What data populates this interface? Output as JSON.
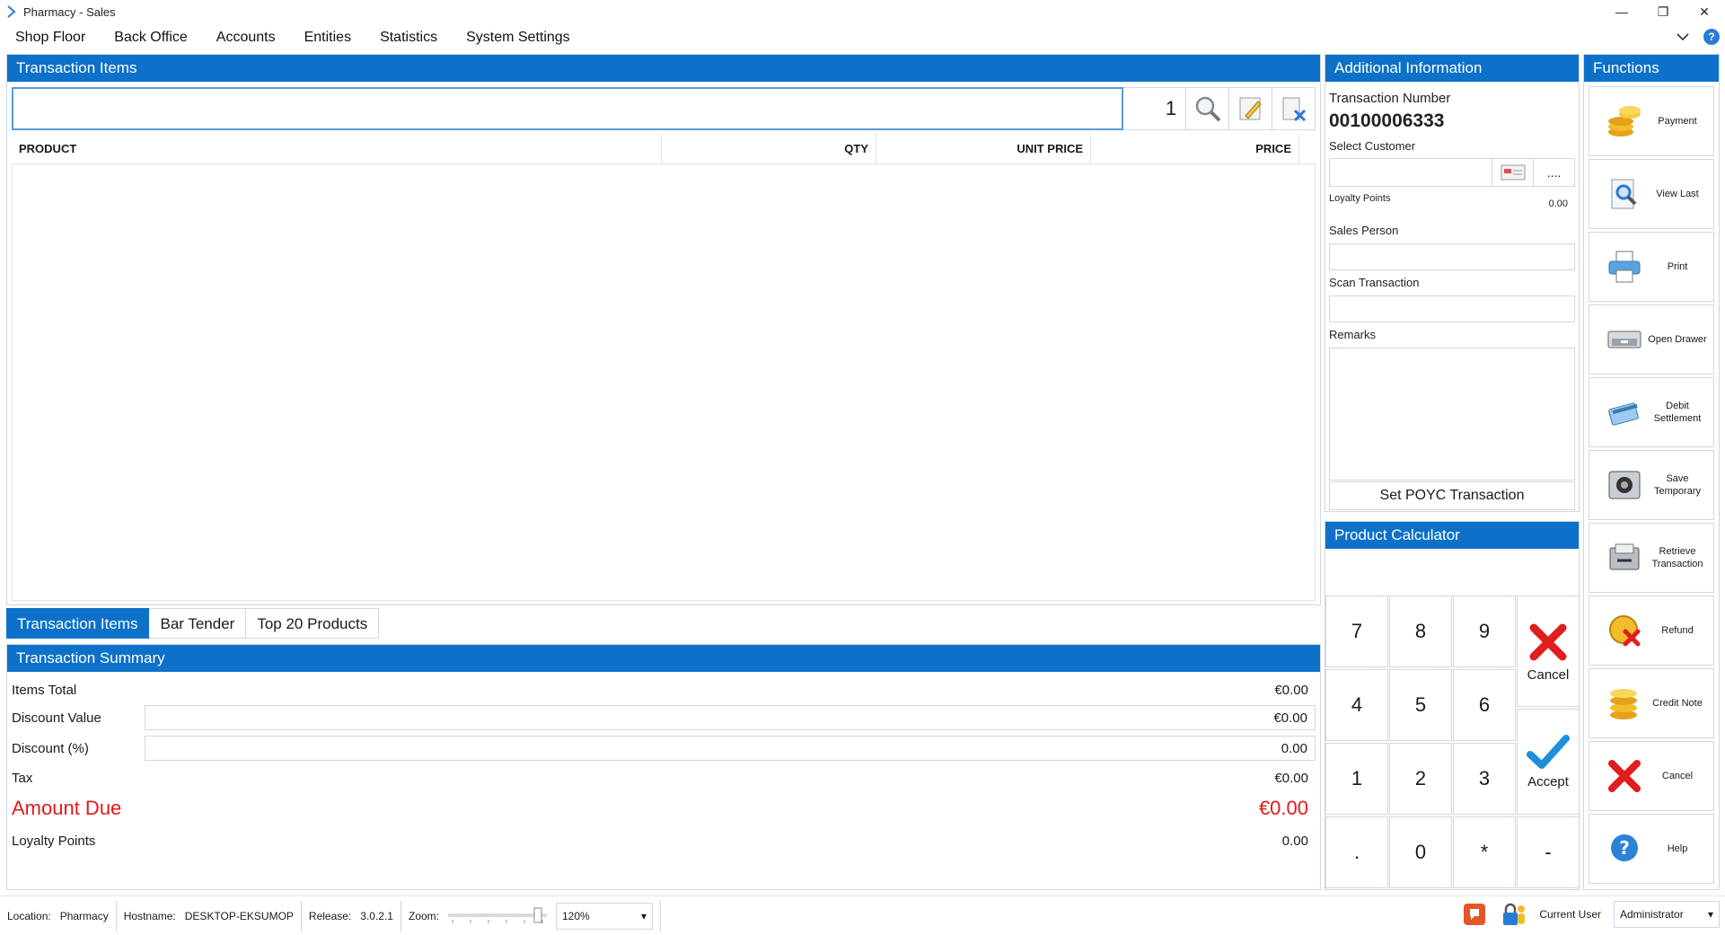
{
  "window": {
    "title": "Pharmacy - Sales",
    "minimize": "—",
    "restore": "❐",
    "close": "✕"
  },
  "menu": {
    "items": [
      "Shop Floor",
      "Back Office",
      "Accounts",
      "Entities",
      "Statistics",
      "System Settings"
    ]
  },
  "transaction_items": {
    "header": "Transaction Items",
    "search_value": "",
    "qty": "1",
    "columns": [
      "PRODUCT",
      "QTY",
      "UNIT PRICE",
      "PRICE"
    ]
  },
  "tabs": [
    "Transaction Items",
    "Bar Tender",
    "Top 20 Products"
  ],
  "summary": {
    "header": "Transaction Summary",
    "items_total_label": "Items Total",
    "items_total": "€0.00",
    "discount_value_label": "Discount Value",
    "discount_value": "€0.00",
    "discount_pct_label": "Discount (%)",
    "discount_pct": "0.00",
    "tax_label": "Tax",
    "tax": "€0.00",
    "amount_due_label": "Amount Due",
    "amount_due": "€0.00",
    "loyalty_label": "Loyalty Points",
    "loyalty": "0.00"
  },
  "additional_info": {
    "header": "Additional Information",
    "txn_number_label": "Transaction Number",
    "txn_number": "00100006333",
    "select_customer_label": "Select Customer",
    "more_label": "....",
    "loyalty_points_label": "Loyalty Points",
    "loyalty_points": "0.00",
    "sales_person_label": "Sales Person",
    "scan_transaction_label": "Scan Transaction",
    "remarks_label": "Remarks",
    "poyc_button": "Set POYC Transaction"
  },
  "calculator": {
    "header": "Product Calculator",
    "keys": [
      "7",
      "8",
      "9",
      "4",
      "5",
      "6",
      "1",
      "2",
      "3",
      ".",
      "0",
      "*",
      "-"
    ],
    "cancel_label": "Cancel",
    "accept_label": "Accept"
  },
  "functions": {
    "header": "Functions",
    "buttons": [
      {
        "label": "Payment",
        "icon": "coins-icon"
      },
      {
        "label": "View Last",
        "icon": "magnifier-doc-icon"
      },
      {
        "label": "Print",
        "icon": "printer-icon"
      },
      {
        "label": "Open Drawer",
        "icon": "cash-drawer-icon"
      },
      {
        "label": "Debit Settlement",
        "icon": "card-icon"
      },
      {
        "label": "Save Temporary",
        "icon": "safe-icon"
      },
      {
        "label": "Retrieve Transaction",
        "icon": "retrieve-icon"
      },
      {
        "label": "Refund",
        "icon": "refund-icon"
      },
      {
        "label": "Credit Note",
        "icon": "credit-note-icon"
      },
      {
        "label": "Cancel",
        "icon": "cancel-x-icon"
      },
      {
        "label": "Help",
        "icon": "help-icon"
      }
    ]
  },
  "status": {
    "location_label": "Location:",
    "location": "Pharmacy",
    "hostname_label": "Hostname:",
    "hostname": "DESKTOP-EKSUMOP",
    "release_label": "Release:",
    "release": "3.0.2.1",
    "zoom_label": "Zoom:",
    "zoom": "120%",
    "current_user_label": "Current User",
    "current_user": "Administrator"
  },
  "colors": {
    "accent": "#0d71c9",
    "amount_due": "#e11a1a"
  }
}
